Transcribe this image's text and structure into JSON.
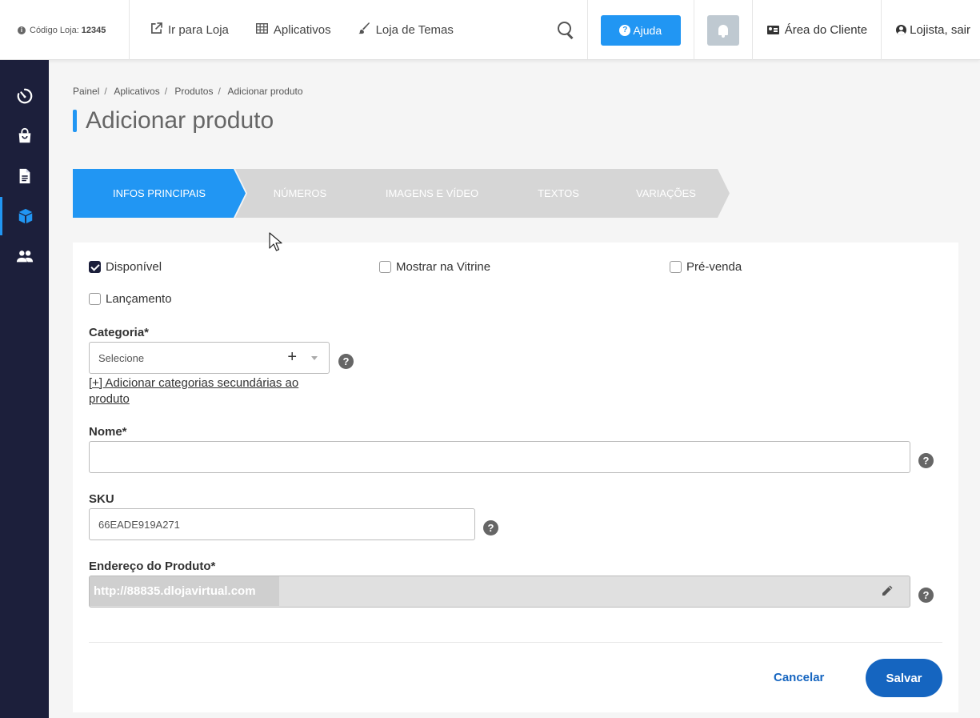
{
  "topbar": {
    "store_code_label": "Código Loja:",
    "store_code_value": "12345",
    "nav": [
      {
        "label": "Ir para Loja",
        "icon": "external-link-icon"
      },
      {
        "label": "Aplicativos",
        "icon": "grid-icon"
      },
      {
        "label": "Loja de Temas",
        "icon": "brush-icon"
      }
    ],
    "help_label": "Ajuda",
    "client_area_label": "Área do Cliente",
    "user_label": "Lojista, sair"
  },
  "sidebar": {
    "items": [
      {
        "icon": "dashboard-timer-icon",
        "active": false
      },
      {
        "icon": "shopping-bag-icon",
        "active": false
      },
      {
        "icon": "document-icon",
        "active": false
      },
      {
        "icon": "box-icon",
        "active": true
      },
      {
        "icon": "users-icon",
        "active": false
      }
    ]
  },
  "breadcrumb": [
    "Painel",
    "Aplicativos",
    "Produtos",
    "Adicionar produto"
  ],
  "page_title": "Adicionar produto",
  "steps": [
    {
      "label": "Infos Principais",
      "active": true
    },
    {
      "label": "Números",
      "active": false
    },
    {
      "label": "Imagens e Vídeo",
      "active": false
    },
    {
      "label": "Textos",
      "active": false
    },
    {
      "label": "Variações",
      "active": false
    }
  ],
  "form": {
    "checkboxes": {
      "disponivel": {
        "label": "Disponível",
        "checked": true
      },
      "vitrine": {
        "label": "Mostrar na Vitrine",
        "checked": false
      },
      "prevenda": {
        "label": "Pré-venda",
        "checked": false
      },
      "lancamento": {
        "label": "Lançamento",
        "checked": false
      }
    },
    "categoria_label": "Categoria*",
    "categoria_value": "Selecione",
    "add_categories_link": "[+] Adicionar categorias secundárias ao produto",
    "nome_label": "Nome*",
    "nome_value": "",
    "sku_label": "SKU",
    "sku_value": "66EADE919A271",
    "endereco_label": "Endereço do Produto*",
    "endereco_prefix": "http://88835.dlojavirtual.com",
    "endereco_value": "",
    "help_glyph": "?",
    "cancel_label": "Cancelar",
    "save_label": "Salvar"
  },
  "colors": {
    "sidebar_bg": "#1c1f3b",
    "accent_blue": "#2196f3",
    "primary_button": "#1565c0",
    "step_inactive": "#d6d6d6"
  }
}
